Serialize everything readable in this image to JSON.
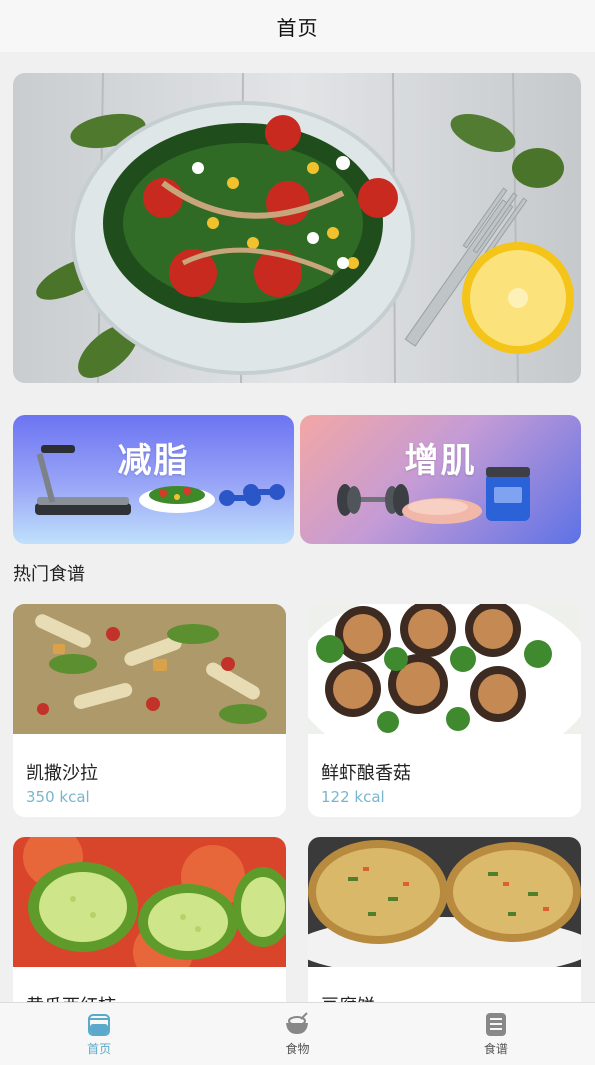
{
  "header": {
    "title": "首页"
  },
  "categories": [
    {
      "label": "减脂"
    },
    {
      "label": "增肌"
    }
  ],
  "section_title": "热门食谱",
  "recipes": [
    {
      "name": "凯撒沙拉",
      "kcal": "350 kcal"
    },
    {
      "name": "鲜虾酿香菇",
      "kcal": "122 kcal"
    },
    {
      "name": "黄瓜西红柿",
      "kcal": ""
    },
    {
      "name": "豆腐饼",
      "kcal": ""
    }
  ],
  "tabbar": {
    "items": [
      {
        "label": "首页",
        "icon": "cup-icon"
      },
      {
        "label": "食物",
        "icon": "bowl-icon"
      },
      {
        "label": "食谱",
        "icon": "list-icon"
      }
    ],
    "active_color": "#5aa9cc",
    "inactive_color": "#888888"
  }
}
